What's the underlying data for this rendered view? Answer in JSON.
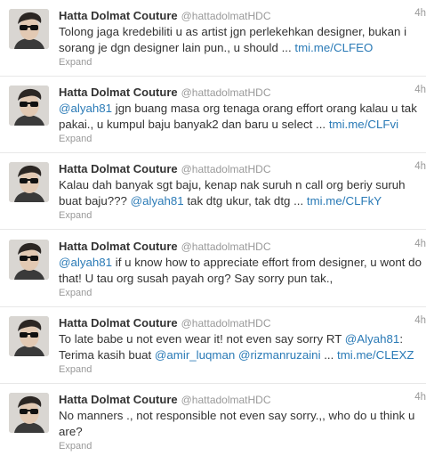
{
  "colors": {
    "name": "#333333",
    "meta": "#999999",
    "link": "#2a7ab6",
    "divider": "#e8e8e8"
  },
  "tweets": [
    {
      "fullname": "Hatta Dolmat Couture",
      "username": "@hattadolmatHDC",
      "time": "4h",
      "expand": "Expand",
      "line1": {
        "a": "Tolong jaga kredebiliti u as artist jgn perlekehkan designer, bukan i"
      },
      "line2": {
        "a": "sorang je dgn designer lain pun., u should ... ",
        "link": "tmi.me/CLFEO"
      }
    },
    {
      "fullname": "Hatta Dolmat Couture",
      "username": "@hattadolmatHDC",
      "time": "4h",
      "expand": "Expand",
      "line1": {
        "mention": "@alyah81",
        "a": " jgn buang masa org tenaga orang effort orang kalau u tak"
      },
      "line2": {
        "a": "pakai., u kumpul baju banyak2 dan baru u select ... ",
        "link": "tmi.me/CLFvi"
      }
    },
    {
      "fullname": "Hatta Dolmat Couture",
      "username": "@hattadolmatHDC",
      "time": "4h",
      "expand": "Expand",
      "line1": {
        "a": "Kalau dah banyak sgt baju, kenap nak suruh n call org beriy suruh"
      },
      "line2": {
        "a": "buat baju??? ",
        "mention": "@alyah81",
        "b": " tak dtg ukur, tak dtg ... ",
        "link": "tmi.me/CLFkY"
      }
    },
    {
      "fullname": "Hatta Dolmat Couture",
      "username": "@hattadolmatHDC",
      "time": "4h",
      "expand": "Expand",
      "line1": {
        "mention": "@alyah81",
        "a": " if u know how to appreciate effort from designer, u wont do"
      },
      "line2": {
        "a": "that! U tau org susah payah org? Say sorry pun tak.,"
      }
    },
    {
      "fullname": "Hatta Dolmat Couture",
      "username": "@hattadolmatHDC",
      "time": "4h",
      "expand": "Expand",
      "line1": {
        "a": "To late babe u not even wear it! not even say sorry RT ",
        "mention": "@Alyah81",
        "b": ":"
      },
      "line2": {
        "a": "Terima kasih buat ",
        "mention": "@amir_luqman",
        "mention2": "@rizmanruzaini",
        "b": " ... ",
        "link": "tmi.me/CLEXZ"
      }
    },
    {
      "fullname": "Hatta Dolmat Couture",
      "username": "@hattadolmatHDC",
      "time": "4h",
      "expand": "Expand",
      "line1": {
        "a": "No manners ., not responsible not even say sorry.,, who do u think u"
      },
      "line2": {
        "a": "are?"
      }
    }
  ]
}
